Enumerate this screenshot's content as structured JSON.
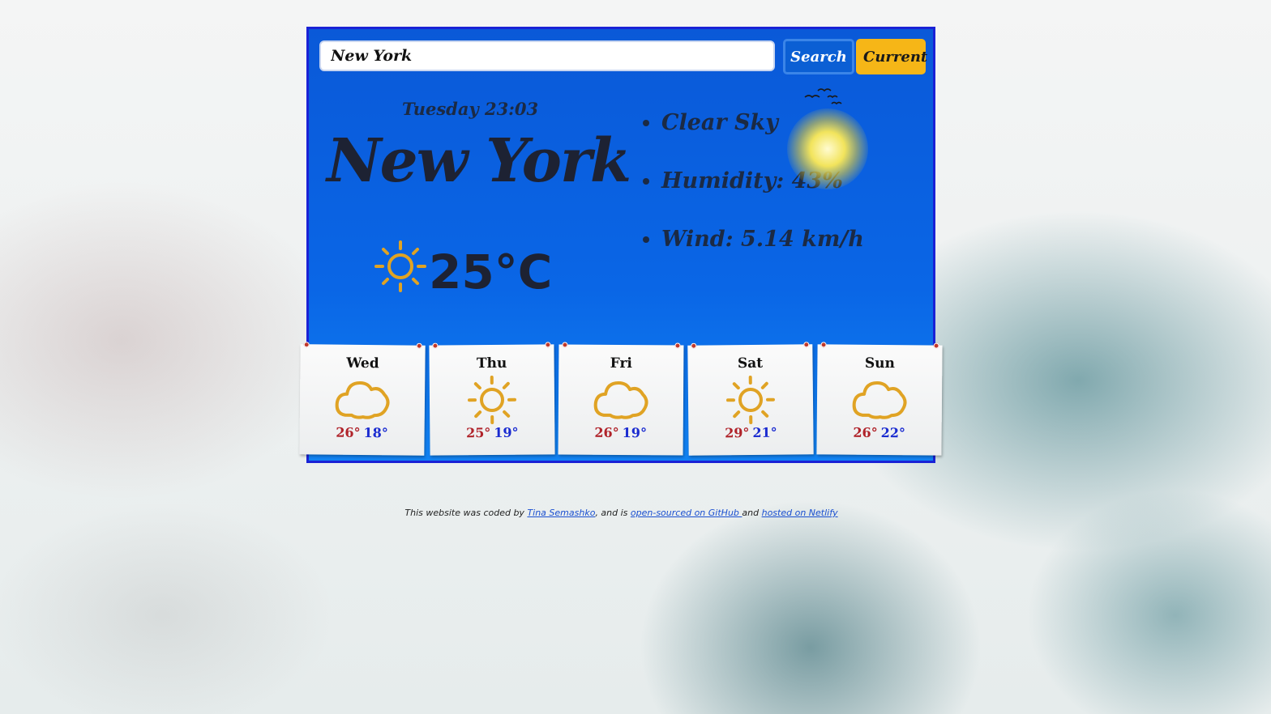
{
  "search": {
    "value": "New York",
    "search_label": "Search",
    "current_label": "Current"
  },
  "current": {
    "datetime": "Tuesday 23:03",
    "city": "New York",
    "temperature": "25°C",
    "icon": "sun-icon",
    "details": {
      "description": "Clear Sky",
      "humidity": "Humidity: 43%",
      "wind": "Wind: 5.14 km/h"
    }
  },
  "forecast": [
    {
      "day": "Wed",
      "icon": "cloud-icon",
      "max": "26°",
      "min": "18°"
    },
    {
      "day": "Thu",
      "icon": "sun-icon",
      "max": "25°",
      "min": "19°"
    },
    {
      "day": "Fri",
      "icon": "cloud-icon",
      "max": "26°",
      "min": "19°"
    },
    {
      "day": "Sat",
      "icon": "sun-icon",
      "max": "29°",
      "min": "21°"
    },
    {
      "day": "Sun",
      "icon": "cloud-icon",
      "max": "26°",
      "min": "22°"
    }
  ],
  "footer": {
    "prefix": "This website was coded by ",
    "author_link": "Tina Semashko",
    "middle": ", and is ",
    "github_link": "open-sourced on GitHub ",
    "and_text": "and ",
    "netlify_link": "hosted on Netlify"
  },
  "colors": {
    "app_blue": "#0a5fd8",
    "border_blue": "#1a22d6",
    "current_button": "#f6b617",
    "max_temp": "#b0232a",
    "min_temp": "#1a2bd0",
    "icon_gold": "#e0a324"
  }
}
